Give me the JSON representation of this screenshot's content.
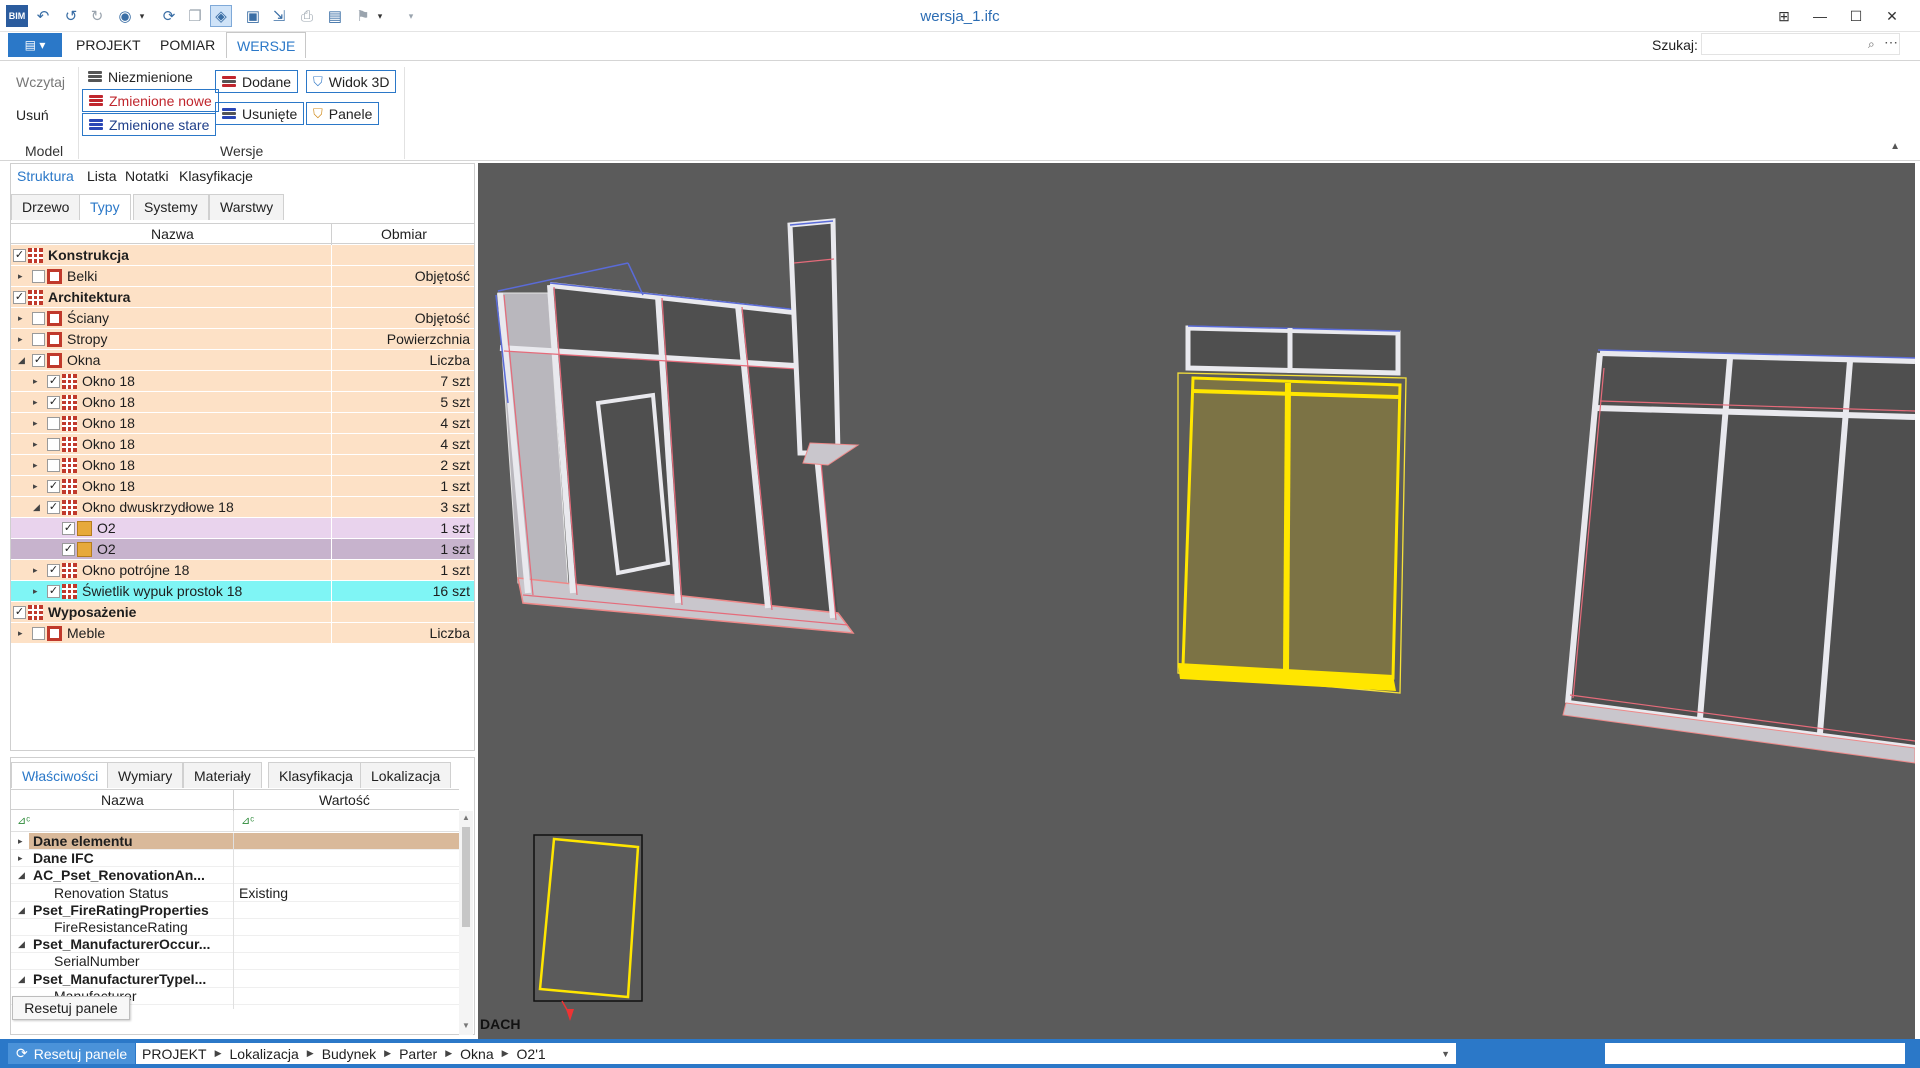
{
  "window": {
    "title": "wersja_1.ifc"
  },
  "qat": {
    "icons": [
      "app-logo-icon",
      "undo-icon",
      "undo-alt-icon",
      "redo-icon",
      "eye-icon",
      "dropdown-icon",
      "refresh-icon",
      "copy-icon",
      "cube-icon",
      "camera-icon",
      "share-icon",
      "print-icon",
      "printer-icon",
      "flag-icon",
      "dropdown-icon",
      "overflow-icon"
    ]
  },
  "ribbon_tabs": {
    "file": "▤ ▾",
    "projekt": "PROJEKT",
    "pomiar": "POMIAR",
    "wersje": "WERSJE"
  },
  "search": {
    "label": "Szukaj:",
    "value": ""
  },
  "ribbon": {
    "wczytaj": "Wczytaj",
    "usun": "Usuń",
    "niezmienione": "Niezmienione",
    "zmienione_nowe": "Zmienione nowe",
    "zmienione_stare": "Zmienione stare",
    "dodane": "Dodane",
    "usuniete": "Usunięte",
    "widok3d": "Widok 3D",
    "panele": "Panele",
    "group_model": "Model",
    "group_wersje": "Wersje"
  },
  "left_tabs": {
    "struktura": "Struktura",
    "lista": "Lista",
    "notatki": "Notatki",
    "klasyfikacje": "Klasyfikacje"
  },
  "sub_tabs": {
    "drzewo": "Drzewo",
    "typy": "Typy",
    "systemy": "Systemy",
    "warstwy": "Warstwy"
  },
  "tree_header": {
    "nazwa": "Nazwa",
    "obmiar": "Obmiar"
  },
  "tree": [
    {
      "name": "Konstrukcja",
      "measure": "",
      "level": 0,
      "bold": true,
      "checked": true,
      "chevron": "",
      "icon": "grid",
      "style": ""
    },
    {
      "name": "Belki",
      "measure": "Objętość",
      "level": 1,
      "checked": false,
      "chevron": "▸",
      "icon": "sq",
      "style": ""
    },
    {
      "name": "Architektura",
      "measure": "",
      "level": 0,
      "bold": true,
      "checked": true,
      "chevron": "",
      "icon": "grid",
      "style": ""
    },
    {
      "name": "Ściany",
      "measure": "Objętość",
      "level": 1,
      "checked": false,
      "chevron": "▸",
      "icon": "sq",
      "style": ""
    },
    {
      "name": "Stropy",
      "measure": "Powierzchnia",
      "level": 1,
      "checked": false,
      "chevron": "▸",
      "icon": "sq",
      "style": ""
    },
    {
      "name": "Okna",
      "measure": "Liczba",
      "level": 1,
      "checked": true,
      "chevron": "◢",
      "icon": "sq",
      "style": ""
    },
    {
      "name": "Okno 18",
      "measure": "7 szt",
      "level": 2,
      "checked": true,
      "chevron": "▸",
      "icon": "grid",
      "style": ""
    },
    {
      "name": "Okno 18",
      "measure": "5 szt",
      "level": 2,
      "checked": true,
      "chevron": "▸",
      "icon": "grid",
      "style": ""
    },
    {
      "name": "Okno 18",
      "measure": "4 szt",
      "level": 2,
      "checked": false,
      "chevron": "▸",
      "icon": "grid",
      "style": ""
    },
    {
      "name": "Okno 18",
      "measure": "4 szt",
      "level": 2,
      "checked": false,
      "chevron": "▸",
      "icon": "grid",
      "style": ""
    },
    {
      "name": "Okno 18",
      "measure": "2 szt",
      "level": 2,
      "checked": false,
      "chevron": "▸",
      "icon": "grid",
      "style": ""
    },
    {
      "name": "Okno 18",
      "measure": "1 szt",
      "level": 2,
      "checked": true,
      "chevron": "▸",
      "icon": "grid",
      "style": ""
    },
    {
      "name": "Okno dwuskrzydłowe 18",
      "measure": "3 szt",
      "level": 2,
      "checked": true,
      "chevron": "◢",
      "icon": "grid",
      "style": ""
    },
    {
      "name": "O2",
      "measure": "1 szt",
      "level": 3,
      "checked": true,
      "chevron": "",
      "icon": "yel",
      "style": "purple"
    },
    {
      "name": "O2",
      "measure": "1 szt",
      "level": 3,
      "checked": true,
      "chevron": "",
      "icon": "yel",
      "style": "purple-sel"
    },
    {
      "name": "Okno potrójne 18",
      "measure": "1 szt",
      "level": 2,
      "checked": true,
      "chevron": "▸",
      "icon": "grid",
      "style": ""
    },
    {
      "name": "Świetlik wypuk prostok 18",
      "measure": "16 szt",
      "level": 2,
      "checked": true,
      "chevron": "▸",
      "icon": "grid",
      "style": "cyan"
    },
    {
      "name": "Wyposażenie",
      "measure": "",
      "level": 0,
      "bold": true,
      "checked": true,
      "chevron": "",
      "icon": "grid",
      "style": ""
    },
    {
      "name": "Meble",
      "measure": "Liczba",
      "level": 1,
      "checked": false,
      "chevron": "▸",
      "icon": "sq",
      "style": ""
    }
  ],
  "prop_tabs": {
    "wlasciwosci": "Właściwości",
    "wymiary": "Wymiary",
    "materialy": "Materiały",
    "klasyfikacja": "Klasyfikacja",
    "lokalizacja": "Lokalizacja"
  },
  "prop_header": {
    "nazwa": "Nazwa",
    "wartosc": "Wartość"
  },
  "props": [
    {
      "key": "Dane elementu",
      "value": "",
      "bold": true,
      "chevron": "▸",
      "indent": 0,
      "hl": true
    },
    {
      "key": "Dane IFC",
      "value": "",
      "bold": true,
      "chevron": "▸",
      "indent": 0
    },
    {
      "key": "AC_Pset_RenovationAn...",
      "value": "",
      "bold": true,
      "chevron": "◢",
      "indent": 0
    },
    {
      "key": "Renovation Status",
      "value": "Existing",
      "bold": false,
      "chevron": "",
      "indent": 1
    },
    {
      "key": "Pset_FireRatingProperties",
      "value": "",
      "bold": true,
      "chevron": "◢",
      "indent": 0
    },
    {
      "key": "FireResistanceRating",
      "value": "",
      "bold": false,
      "chevron": "",
      "indent": 1
    },
    {
      "key": "Pset_ManufacturerOccur...",
      "value": "",
      "bold": true,
      "chevron": "◢",
      "indent": 0
    },
    {
      "key": "SerialNumber",
      "value": "",
      "bold": false,
      "chevron": "",
      "indent": 1
    },
    {
      "key": "Pset_ManufacturerTypeI...",
      "value": "",
      "bold": true,
      "chevron": "◢",
      "indent": 0
    },
    {
      "key": "Manufacturer",
      "value": "",
      "bold": false,
      "chevron": "",
      "indent": 1
    }
  ],
  "floating_reset": "Resetuj panele",
  "viewport": {
    "label": "DACH"
  },
  "status": {
    "reset": "Resetuj panele",
    "crumbs": [
      "PROJEKT",
      "Lokalizacja",
      "Budynek",
      "Parter",
      "Okna",
      "O2'1"
    ]
  }
}
